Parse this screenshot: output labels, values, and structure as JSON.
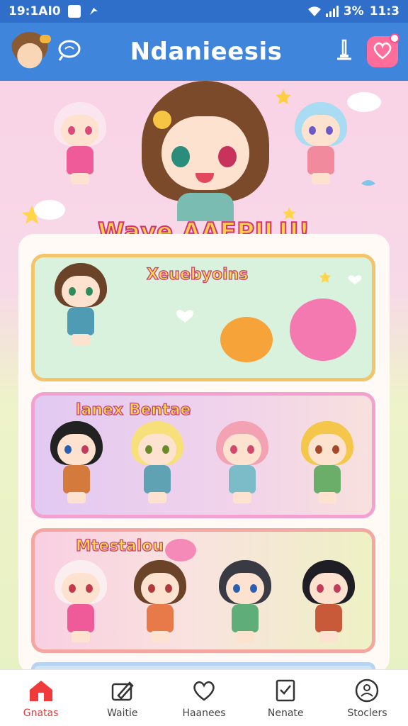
{
  "status_bar": {
    "time": "19:1AI0",
    "battery": "3%",
    "clock_right": "11:3"
  },
  "app_bar": {
    "title": "Ndanieesis",
    "icons": [
      "avatar",
      "search-icon",
      "pen-icon",
      "heart-icon"
    ]
  },
  "hero": {
    "banner_text": "Wave AAEPILU!"
  },
  "cards": [
    {
      "label": "Xeuebyoins"
    },
    {
      "label": "lanex Bentae"
    },
    {
      "label": "Mtestalou"
    }
  ],
  "bottom_nav": {
    "items": [
      {
        "label": "Gnatas",
        "icon": "home-icon",
        "active": true
      },
      {
        "label": "Waitie",
        "icon": "edit-icon",
        "active": false
      },
      {
        "label": "Haanees",
        "icon": "heart-hands-icon",
        "active": false
      },
      {
        "label": "Nenate",
        "icon": "checklist-icon",
        "active": false
      },
      {
        "label": "Stoclers",
        "icon": "profile-icon",
        "active": false
      }
    ]
  },
  "colors": {
    "status_bar": "#2f6fc9",
    "app_bar": "#3f85dc",
    "accent_pink": "#ff6e9a",
    "active_nav": "#e53b3b"
  }
}
